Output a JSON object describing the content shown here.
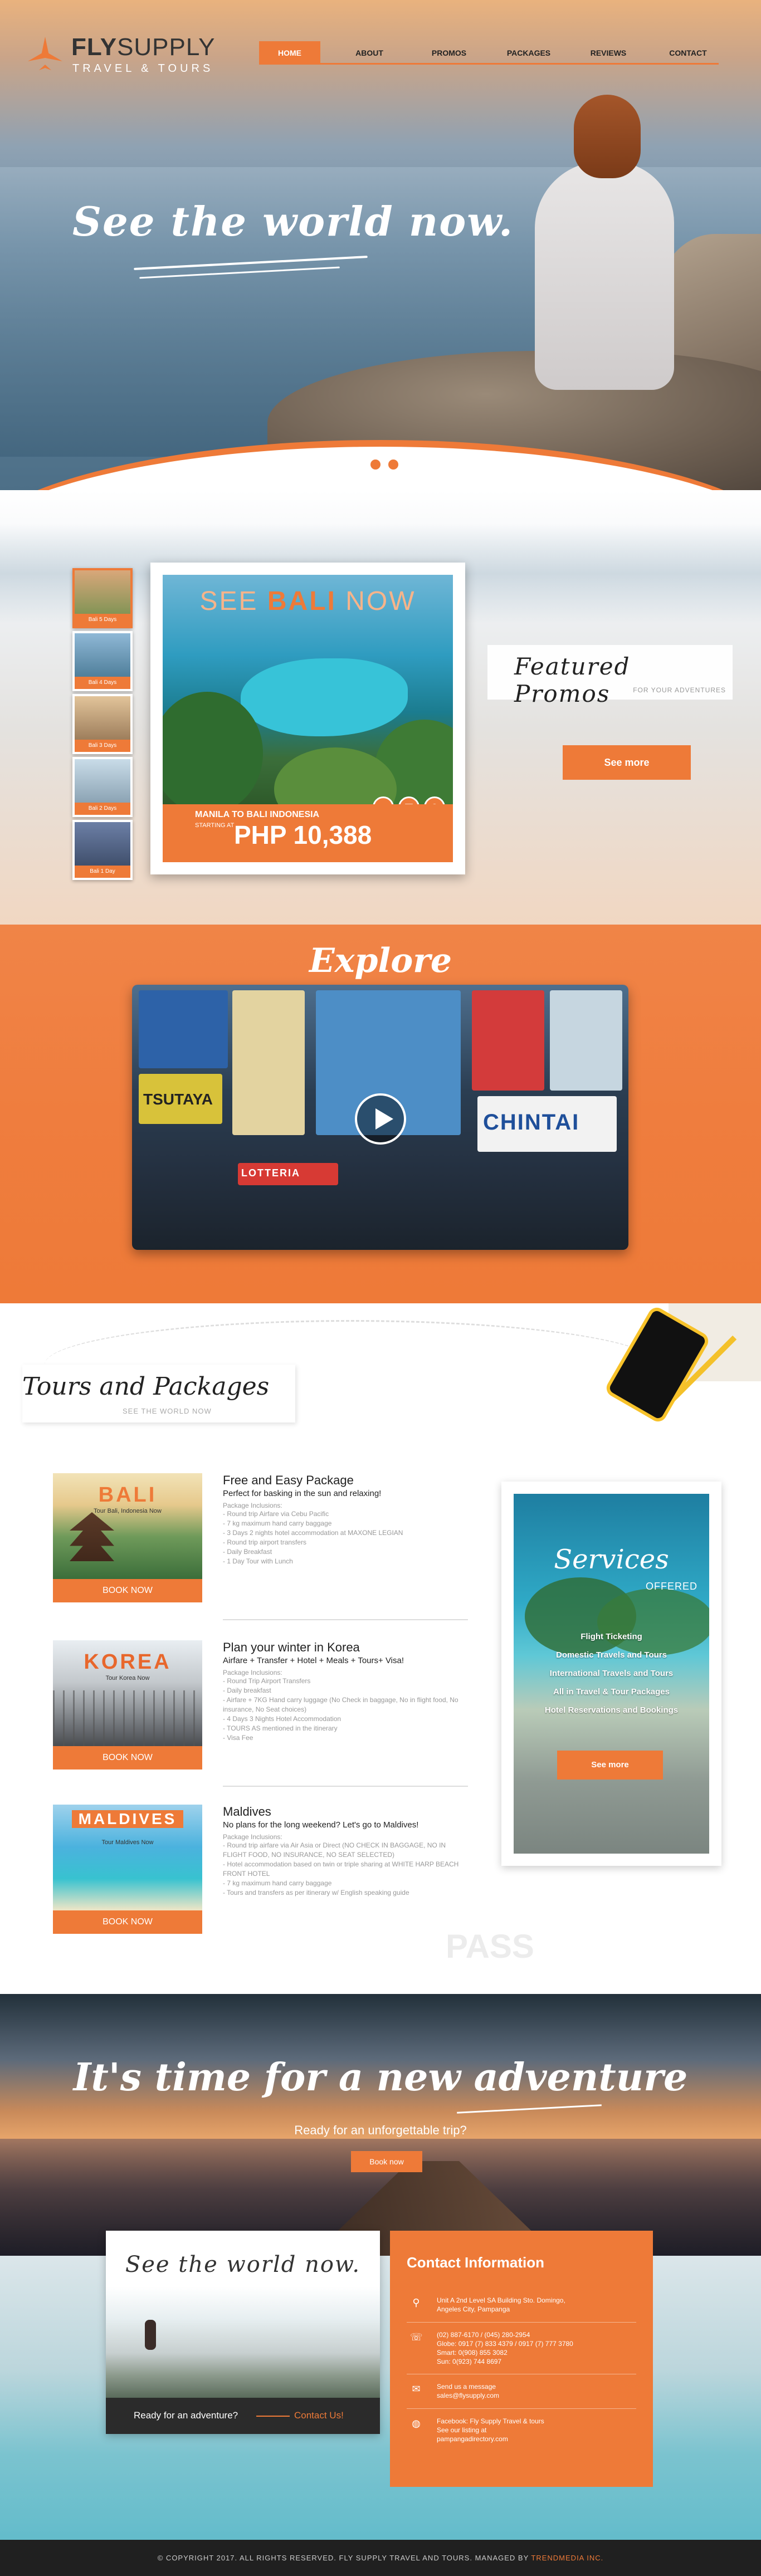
{
  "brand": {
    "name_bold": "FLY",
    "name_rest": "SUPPLY",
    "tagline": "TRAVEL & TOURS"
  },
  "nav": {
    "items": [
      "HOME",
      "ABOUT",
      "PROMOS",
      "PACKAGES",
      "REVIEWS",
      "CONTACT"
    ],
    "active": "HOME"
  },
  "hero": {
    "title": "See the world now.",
    "slides_count": 3,
    "active_slide": 1
  },
  "promos": {
    "thumbs": [
      "Bali 5 Days",
      "Bali 4 Days",
      "Bali 3 Days",
      "Bali 2 Days",
      "Bali 1 Day"
    ],
    "card": {
      "head_see": "SEE ",
      "head_bali": "BALI",
      "head_now": " NOW",
      "route": "MANILA TO BALI INDONESIA",
      "starting": "STARTING AT",
      "price": "PHP 10,388"
    },
    "title": "Featured Promos",
    "subtitle": "FOR YOUR ADVENTURES",
    "cta": "See more"
  },
  "explore": {
    "title": "Explore",
    "signs": {
      "chintai": "CHINTAI",
      "lotteria": "LOTTERIA",
      "tsutaya": "TSUTAYA"
    }
  },
  "tours": {
    "title": "Tours and Packages",
    "subtitle": "SEE THE WORLD NOW",
    "packages": [
      {
        "img_name": "BALI",
        "img_tag": "Tour Bali, Indonesia Now",
        "book": "BOOK NOW",
        "title": "Free and Easy Package",
        "lead": "Perfect for basking in the sun and relaxing!",
        "inclusions_label": "Package Inclusions:",
        "items": [
          "- Round trip Airfare via Cebu Pacific",
          "- 7 kg maximum hand carry baggage",
          "- 3 Days 2 nights hotel accommodation at MAXONE LEGIAN",
          "- Round trip airport transfers",
          "- Daily Breakfast",
          "- 1 Day Tour with Lunch"
        ]
      },
      {
        "img_name": "KOREA",
        "img_tag": "Tour Korea Now",
        "book": "BOOK NOW",
        "title": "Plan your winter in Korea",
        "lead": "Airfare + Transfer + Hotel + Meals + Tours+ Visa!",
        "inclusions_label": "Package Inclusions:",
        "items": [
          "- Round Trip Airport Transfers",
          "- Daily breakfast",
          "- Airfare + 7KG Hand carry luggage (No Check in baggage, No in flight food, No insurance, No Seat choices)",
          "- 4 Days 3 Nights Hotel Accommodation",
          "- TOURS AS mentioned in the itinerary",
          "- Visa Fee"
        ]
      },
      {
        "img_name": "MALDIVES",
        "img_tag": "Tour Maldives Now",
        "book": "BOOK NOW",
        "title": "Maldives",
        "lead": "No plans for the long weekend? Let's go to Maldives!",
        "inclusions_label": "Package Inclusions:",
        "items": [
          "- Round trip airfare via Air Asia or Direct (NO CHECK IN BAGGAGE, NO IN FLIGHT FOOD, NO INSURANCE, NO SEAT SELECTED)",
          "- Hotel accommodation based on twin or triple sharing at WHITE HARP BEACH FRONT HOTEL",
          "- 7 kg maximum hand carry baggage",
          "- Tours and transfers as per itinerary w/ English speaking guide"
        ]
      }
    ],
    "watermark_pass": "PASS"
  },
  "services": {
    "title": "Services",
    "subtitle": "OFFERED",
    "items": [
      "Flight Ticketing",
      "Domestic Travels and Tours",
      "International Travels and Tours",
      "All in Travel & Tour Packages",
      "Hotel Reservations and Bookings"
    ],
    "cta": "See more"
  },
  "adventure": {
    "title": "It's time for a new adventure",
    "subtitle": "Ready for an unforgettable trip?",
    "cta": "Book now"
  },
  "contact": {
    "left_title": "See the world now.",
    "ready": "Ready for an adventure?",
    "contact_us": "Contact Us!",
    "right_title": "Contact Information",
    "rows": [
      {
        "icon": "location-pin-icon",
        "glyph": "⚲",
        "lines": [
          "Unit A 2nd Level SA Building Sto. Domingo,",
          "Angeles City, Pampanga"
        ]
      },
      {
        "icon": "phone-icon",
        "glyph": "☏",
        "lines": [
          "(02) 887-6170 / (045) 280-2954",
          "Globe: 0917 (7) 833 4379 / 0917 (7) 777 3780",
          "Smart: 0(908) 855 3082",
          "Sun: 0(923) 744 8697"
        ]
      },
      {
        "icon": "mail-icon",
        "glyph": "✉",
        "lines": [
          "Send us a message",
          "sales@flysupply.com"
        ]
      },
      {
        "icon": "globe-icon",
        "glyph": "◍",
        "lines": [
          "Facebook: Fly Supply Travel & tours",
          "See our listing at",
          "pampangadirectory.com"
        ]
      }
    ]
  },
  "footer": {
    "text": "© COPYRIGHT 2017. ALL RIGHTS RESERVED. FLY SUPPLY TRAVEL AND TOURS. MANAGED BY ",
    "manager": "TRENDMEDIA INC."
  },
  "colors": {
    "accent": "#ee7a38",
    "dark": "#202020"
  }
}
